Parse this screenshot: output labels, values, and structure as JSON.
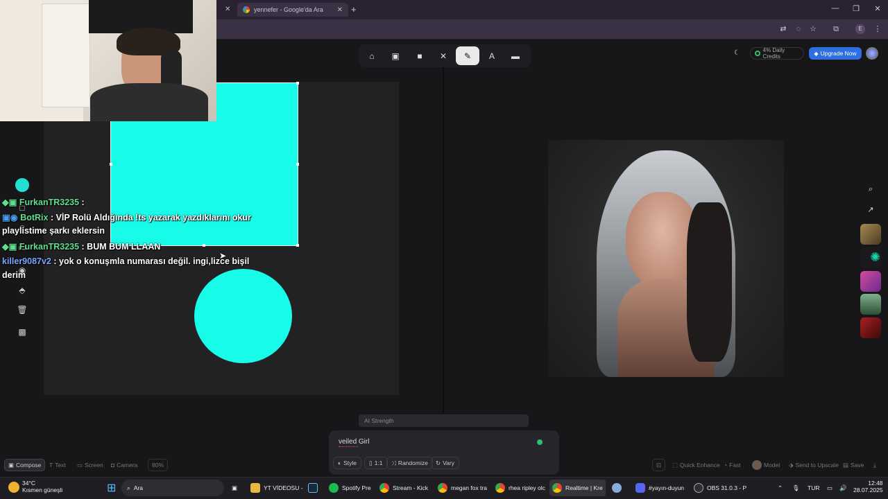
{
  "browser": {
    "tabs": [
      {
        "label": "yennefer - Google'da Ara",
        "active": true
      }
    ],
    "new_tab": "+",
    "profile_initial": "E"
  },
  "toolbar": {
    "tools": [
      "home-icon",
      "image-icon",
      "video-icon",
      "wand-icon",
      "brush-icon",
      "text-icon",
      "folder-icon"
    ],
    "active_tool": 4
  },
  "header": {
    "credits": "4% Daily Credits",
    "upgrade": "Upgrade Now"
  },
  "chat": {
    "messages": [
      {
        "user": "FurkanTR3235",
        "text": " :",
        "user_color": "#5ee08c"
      },
      {
        "user": "BotRix",
        "text": " : VİP Rolü Aldığında !ts yazarak yazdıklarını okur",
        "user_color": "#5ee08c"
      },
      {
        "user": "",
        "text": "playlistime şarkı eklersin",
        "user_color": "#fff"
      },
      {
        "user": "FurkanTR3235",
        "text": " : BUM BUM LLAAN",
        "user_color": "#5ee08c"
      },
      {
        "user": "killer9087v2",
        "text": " : yok o konuşmla numarası değil. ingi,lizce bişil",
        "user_color": "#7aa6ff"
      },
      {
        "user": "",
        "text": "derim",
        "user_color": "#fff"
      }
    ]
  },
  "prompt": {
    "strength_label": "AI Strength",
    "text": "veiled Girl",
    "buttons": [
      "Style",
      "1:1",
      "Randomize",
      "Vary"
    ]
  },
  "bottom_left": {
    "compose": "Compose",
    "text": "Text",
    "screen": "Screen",
    "camera": "Camera",
    "zoom": "80%"
  },
  "bottom_right": {
    "quick_enhance": "Quick Enhance",
    "fast": "Fast",
    "model": "Model",
    "send_upscale": "Send to Upscale",
    "save": "Save"
  },
  "taskbar": {
    "weather_temp": "34°C",
    "weather_desc": "Kısmen güneşli",
    "search": "Ara",
    "apps": [
      {
        "label": "YT VİDEOSU -",
        "color": "#e8b83a"
      },
      {
        "label": "",
        "color": "#1b2838"
      },
      {
        "label": "Spotify Pre",
        "color": "#1db954"
      },
      {
        "label": "Stream - Kick",
        "color": "#db4437"
      },
      {
        "label": "megan fox tra",
        "color": "#db4437"
      },
      {
        "label": "rhea ripley olc",
        "color": "#db4437"
      },
      {
        "label": "Realtime | Kre",
        "color": "#db4437"
      },
      {
        "label": "",
        "color": "#8ad"
      },
      {
        "label": "#yayın-duyun",
        "color": "#5865f2"
      },
      {
        "label": "OBS 31.0.3 - P",
        "color": "#302e31"
      }
    ],
    "lang": "TUR",
    "time": "12:48",
    "date": "28.07.2025"
  }
}
